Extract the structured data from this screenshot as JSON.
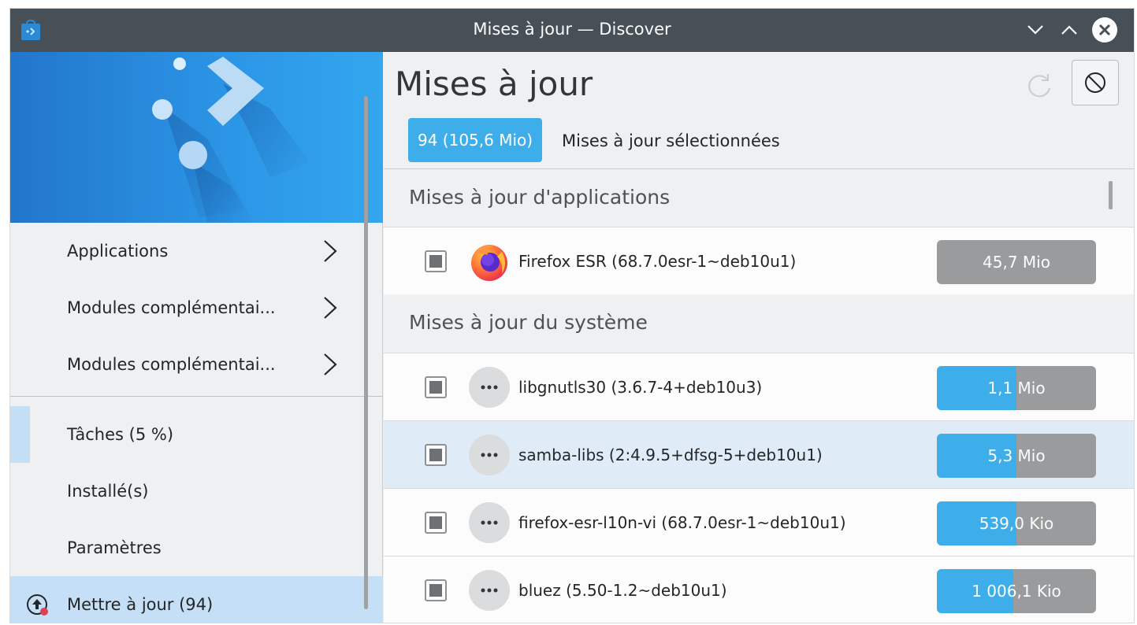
{
  "window": {
    "title": "Mises à jour — Discover"
  },
  "sidebar": {
    "items": [
      {
        "label": "Applications",
        "has_chevron": true
      },
      {
        "label": "Modules complémentai...",
        "has_chevron": true
      },
      {
        "label": "Modules complémentai...",
        "has_chevron": true
      },
      {
        "label": "Tâches (5 %)",
        "progress_percent": 5
      },
      {
        "label": "Installé(s)"
      },
      {
        "label": "Paramètres"
      },
      {
        "label": "Mettre à jour (94)",
        "active": true,
        "icon": "update-icon"
      }
    ]
  },
  "main": {
    "title": "Mises à jour",
    "selection_badge": "94 (105,6 Mio)",
    "selection_label": "Mises à jour sélectionnées",
    "sections": [
      {
        "header": "Mises à jour d'applications",
        "rows": [
          {
            "name": "Firefox ESR (68.7.0esr-1~deb10u1)",
            "size": "45,7 Mio",
            "progress": 0,
            "icon": "firefox-icon"
          }
        ]
      },
      {
        "header": "Mises à jour du système",
        "rows": [
          {
            "name": "libgnutls30 (3.6.7-4+deb10u3)",
            "size": "1,1 Mio",
            "progress": 0.5,
            "icon": "package-icon"
          },
          {
            "name": "samba-libs (2:4.9.5+dfsg-5+deb10u1)",
            "size": "5,3 Mio",
            "progress": 0.5,
            "icon": "package-icon"
          },
          {
            "name": "firefox-esr-l10n-vi (68.7.0esr-1~deb10u1)",
            "size": "539,0 Kio",
            "progress": 0.5,
            "icon": "package-icon"
          },
          {
            "name": "bluez (5.50-1.2~deb10u1)",
            "size": "1 006,1 Kio",
            "progress": 0.48,
            "icon": "package-icon"
          }
        ]
      }
    ]
  },
  "colors": {
    "accent": "#3daee9",
    "titlebar": "#475057",
    "progress_track": "#999b9d",
    "active_nav": "#c5e0f6"
  }
}
